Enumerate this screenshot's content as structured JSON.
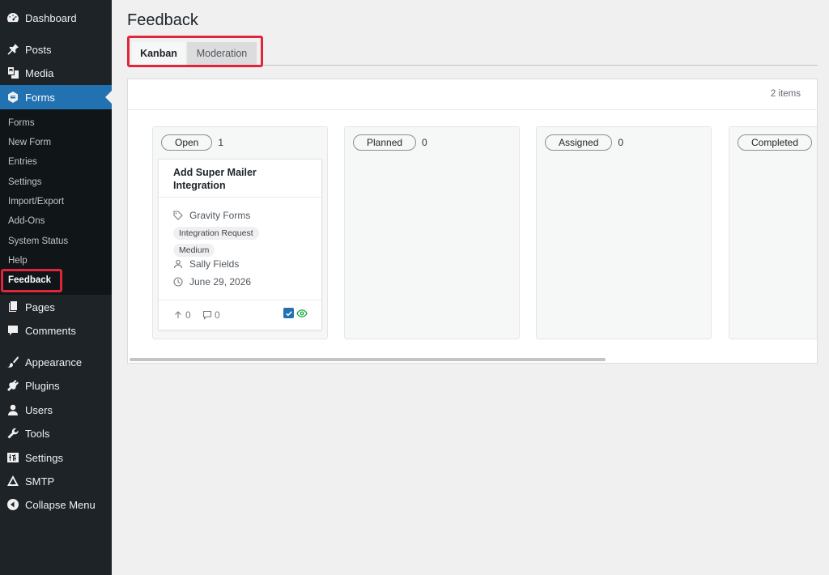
{
  "sidebar": {
    "dashboard": "Dashboard",
    "posts": "Posts",
    "media": "Media",
    "forms": "Forms",
    "submenu": [
      "Forms",
      "New Form",
      "Entries",
      "Settings",
      "Import/Export",
      "Add-Ons",
      "System Status",
      "Help",
      "Feedback"
    ],
    "pages": "Pages",
    "comments": "Comments",
    "appearance": "Appearance",
    "plugins": "Plugins",
    "users": "Users",
    "tools": "Tools",
    "settings": "Settings",
    "smtp": "SMTP",
    "collapse": "Collapse Menu"
  },
  "page": {
    "title": "Feedback",
    "tabs": [
      "Kanban",
      "Moderation"
    ],
    "items_count": "2 items"
  },
  "columns": [
    {
      "name": "Open",
      "count": "1"
    },
    {
      "name": "Planned",
      "count": "0"
    },
    {
      "name": "Assigned",
      "count": "0"
    },
    {
      "name": "Completed",
      "count": ""
    }
  ],
  "card": {
    "title": "Add Super Mailer Integration",
    "form": "Gravity Forms",
    "tags": [
      "Integration Request",
      "Medium"
    ],
    "user": "Sally Fields",
    "date": "June 29, 2026",
    "votes": "0",
    "comments": "0"
  },
  "colors": {
    "sidebar_bg": "#1d2327",
    "accent": "#2271b1",
    "highlight": "#e0263b",
    "eye": "#00a32a"
  }
}
